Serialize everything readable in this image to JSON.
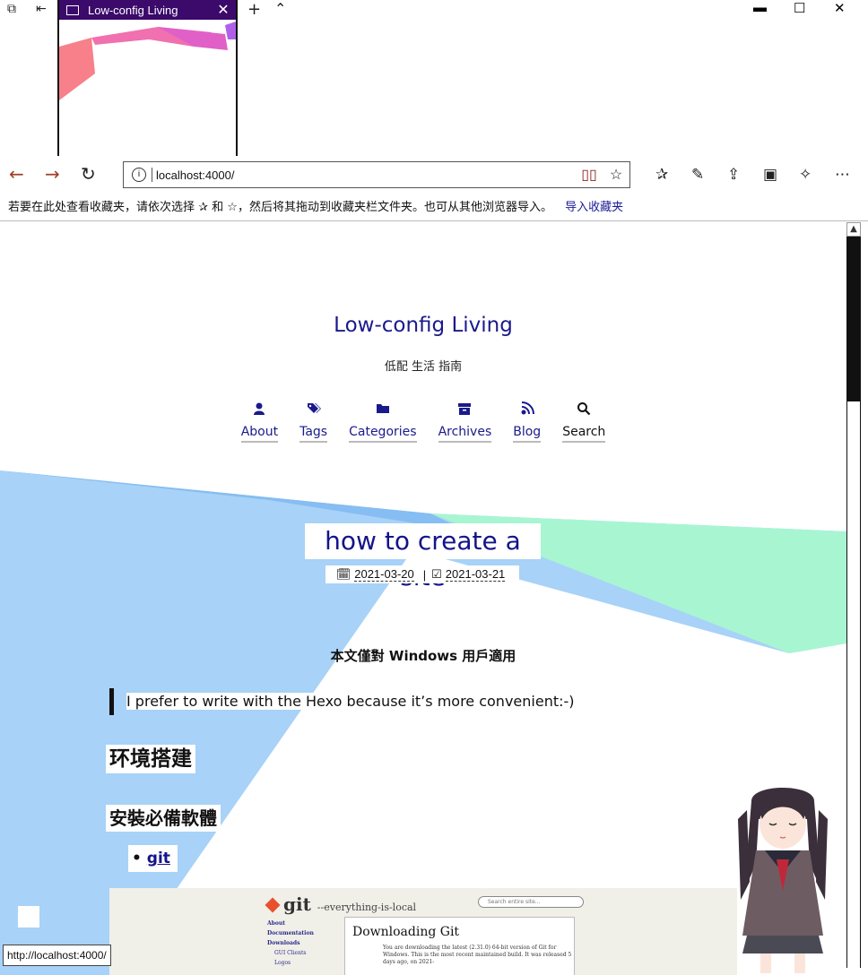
{
  "browser": {
    "tab_title": "Low-config Living",
    "url": "localhost:4000/",
    "favorites_hint": "若要在此处查看收藏夹，请依次选择 ✰ 和 ☆，然后将其拖动到收藏夹栏文件夹。也可从其他浏览器导入。",
    "import_favorites": "导入收藏夹",
    "status_url": "http://localhost:4000/"
  },
  "site": {
    "title": "Low-config Living",
    "subtitle": "低配 生活 指南",
    "menu": [
      {
        "label": "About",
        "icon": "user-icon"
      },
      {
        "label": "Tags",
        "icon": "tags-icon"
      },
      {
        "label": "Categories",
        "icon": "folder-icon"
      },
      {
        "label": "Archives",
        "icon": "archive-icon"
      },
      {
        "label": "Blog",
        "icon": "blog-icon"
      },
      {
        "label": "Search",
        "icon": "search-icon"
      }
    ]
  },
  "post": {
    "title": "how to create a site",
    "created": "2021-03-20",
    "updated": "2021-03-21",
    "separator": "|",
    "lead": "本文僅對 Windows 用戶適用",
    "quote": "I prefer to write with the Hexo because it’s more convenient:-)",
    "heading1": "环境搭建",
    "heading2": "安裝必備軟體",
    "list_item": "git"
  },
  "screenshot": {
    "logo": "git",
    "tagline": "--everything-is-local",
    "search_placeholder": "Search entire site...",
    "side_links": [
      "About",
      "Documentation",
      "Downloads",
      "GUI Clients",
      "Logos"
    ],
    "box_title": "Downloading Git",
    "box_text": "You are downloading the latest (2.31.0) 64-bit version of Git for Windows. This is the most recent maintained build. It was released 5 days ago, on 2021-"
  },
  "colors": {
    "link": "#1a1a8c",
    "tab_active": "#3b0a6b",
    "bg_blue": "#a8d2f7",
    "bg_blue_dark": "#86bdf2",
    "bg_green": "#a8f5d2"
  }
}
